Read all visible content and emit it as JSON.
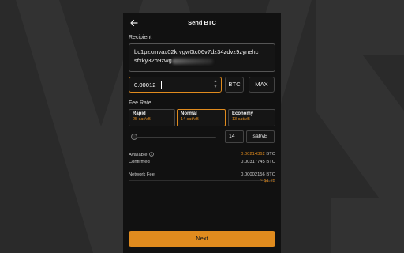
{
  "header": {
    "title": "Send BTC",
    "back_icon": "arrow-left-icon"
  },
  "recipient": {
    "label": "Recipient",
    "line1": "bc1pzxmvax02krvgw0tc06v7dz34zdvz9zynehc",
    "line2": "sfxky32h9zwg"
  },
  "amount": {
    "value": "0.00012",
    "unit": "BTC",
    "max_label": "MAX"
  },
  "fee": {
    "label": "Fee Rate",
    "options": [
      {
        "name": "Rapid",
        "rate": "25 sat/vB"
      },
      {
        "name": "Normal",
        "rate": "14 sat/vB"
      },
      {
        "name": "Economy",
        "rate": "13 sat/vB"
      }
    ],
    "selected": "Normal",
    "custom_value": "14",
    "custom_unit": "sat/vB"
  },
  "summary": {
    "available_label": "Available",
    "available_value": "0.00214362",
    "confirmed_label": "Confirmed",
    "confirmed_value": "0.00317745",
    "unit": "BTC",
    "network_fee_label": "Network Fee",
    "network_fee_value": "0.00002156",
    "network_fee_usd": "~ $1.25"
  },
  "next_label": "Next",
  "colors": {
    "accent": "#e08b1e",
    "panel": "#111111",
    "background": "#2a2a2a"
  }
}
